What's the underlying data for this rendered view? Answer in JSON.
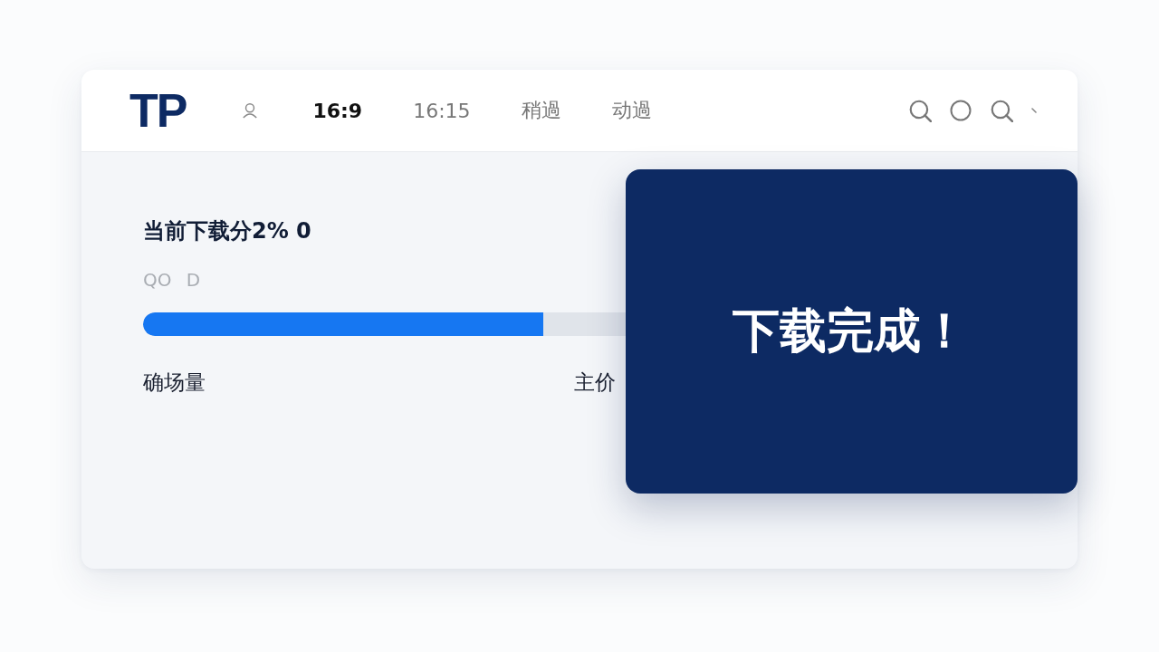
{
  "header": {
    "logo": "TP",
    "tabs": [
      {
        "label": "16:9",
        "selected": true
      },
      {
        "label": "16:15",
        "selected": false
      },
      {
        "label": "稍過",
        "selected": false
      },
      {
        "label": "动過",
        "selected": false
      }
    ]
  },
  "download": {
    "title": "当前下载分2% 0",
    "subtitle": "QO D",
    "progress": {
      "level": 0.83
    },
    "labels": [
      "确场量",
      "主价"
    ]
  },
  "toast": {
    "message": "下载完成！"
  }
}
